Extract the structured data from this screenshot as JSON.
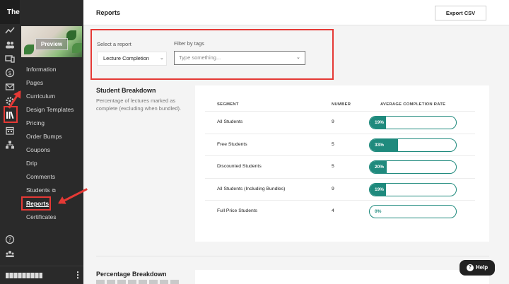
{
  "brand": {
    "title": "The Sweet Shop"
  },
  "preview_label": "Preview",
  "nav": [
    {
      "label": "Information",
      "active": false,
      "external": false
    },
    {
      "label": "Pages",
      "active": false,
      "external": false
    },
    {
      "label": "Curriculum",
      "active": false,
      "external": false
    },
    {
      "label": "Design Templates",
      "active": false,
      "external": false
    },
    {
      "label": "Pricing",
      "active": false,
      "external": false
    },
    {
      "label": "Order Bumps",
      "active": false,
      "external": false
    },
    {
      "label": "Coupons",
      "active": false,
      "external": false
    },
    {
      "label": "Drip",
      "active": false,
      "external": false
    },
    {
      "label": "Comments",
      "active": false,
      "external": false
    },
    {
      "label": "Students",
      "active": false,
      "external": true
    },
    {
      "label": "Reports",
      "active": true,
      "external": false
    },
    {
      "label": "Certificates",
      "active": false,
      "external": false
    }
  ],
  "rail_icons": [
    "analytics-icon",
    "users-icon",
    "site-icon",
    "sales-icon",
    "email-icon",
    "settings-icon",
    "library-icon",
    "calendar-icon",
    "sitemap-icon"
  ],
  "header": {
    "title": "Reports",
    "export_label": "Export CSV"
  },
  "filters": {
    "report_label": "Select a report",
    "report_value": "Lecture Completion",
    "tags_label": "Filter by tags",
    "tags_placeholder": "Type something..."
  },
  "student_breakdown": {
    "title": "Student Breakdown",
    "description_1": "Percentage of lectures marked as",
    "description_2": "complete (excluding when bundled).",
    "columns": [
      "SEGMENT",
      "NUMBER",
      "AVERAGE COMPLETION RATE"
    ],
    "rows": [
      {
        "segment": "All Students",
        "number": "9",
        "rate_label": "19%",
        "rate": 0.19
      },
      {
        "segment": "Free Students",
        "number": "5",
        "rate_label": "33%",
        "rate": 0.33
      },
      {
        "segment": "Discounted Students",
        "number": "5",
        "rate_label": "20%",
        "rate": 0.2
      },
      {
        "segment": "All Students (Including Bundles)",
        "number": "9",
        "rate_label": "19%",
        "rate": 0.19
      },
      {
        "segment": "Full Price Students",
        "number": "4",
        "rate_label": "0%",
        "rate": 0
      }
    ]
  },
  "percentage_breakdown": {
    "title": "Percentage Breakdown"
  },
  "help": {
    "label": "Help"
  },
  "colors": {
    "accent": "#1f8a7d",
    "annotation": "#e53935",
    "sidebar": "#2a2a2a"
  }
}
